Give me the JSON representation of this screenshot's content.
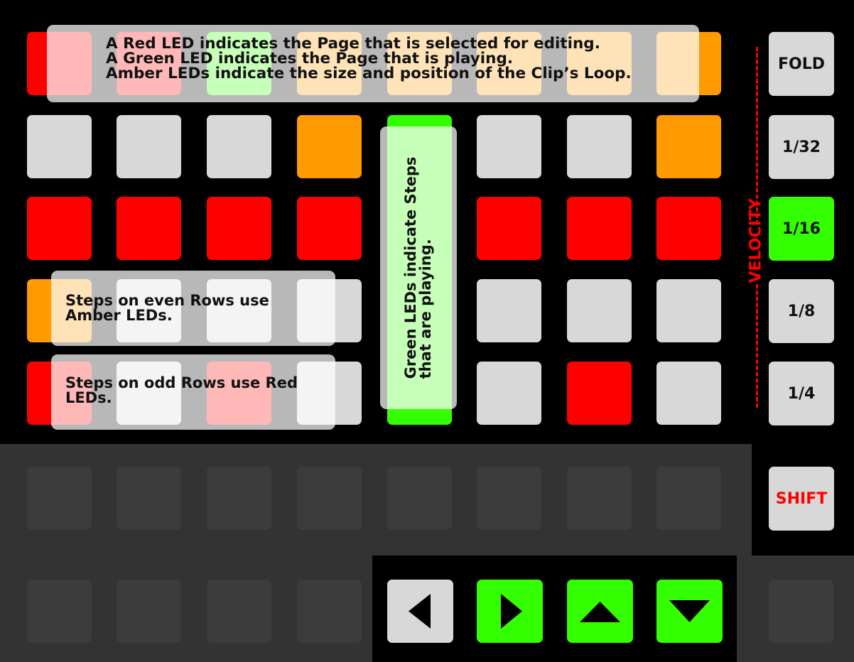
{
  "colors": {
    "red": "#ff0000",
    "amber": "#ff9a00",
    "green": "#33ff00",
    "off": "#d8d8d8",
    "dark_pad": "#3c3c3c",
    "dark_panel": "#333333"
  },
  "grid": {
    "rows": [
      [
        "red",
        "red",
        "green",
        "amber",
        "amber",
        "amber",
        "amber",
        "amber"
      ],
      [
        "off",
        "off",
        "off",
        "amber",
        "green",
        "off",
        "off",
        "amber"
      ],
      [
        "red",
        "red",
        "red",
        "red",
        "green",
        "red",
        "red",
        "red"
      ],
      [
        "amber",
        "off",
        "off",
        "off",
        "green",
        "off",
        "off",
        "off"
      ],
      [
        "red",
        "off",
        "red",
        "off",
        "green",
        "off",
        "red",
        "off"
      ],
      [
        "dark_pad",
        "dark_pad",
        "dark_pad",
        "dark_pad",
        "dark_pad",
        "dark_pad",
        "dark_pad",
        "dark_pad"
      ],
      [
        "dark_pad",
        "dark_pad",
        "dark_pad",
        "dark_pad",
        "off",
        "green",
        "green",
        "green"
      ]
    ]
  },
  "side_buttons": [
    {
      "label": "FOLD",
      "state": "off"
    },
    {
      "label": "1/32",
      "state": "off"
    },
    {
      "label": "1/16",
      "state": "green"
    },
    {
      "label": "1/8",
      "state": "off"
    },
    {
      "label": "1/4",
      "state": "off"
    },
    {
      "label": "SHIFT",
      "state": "off",
      "text_color": "#ff0000"
    }
  ],
  "velocity_label": "VELOCITY",
  "annotations": {
    "top": [
      "A Red LED indicates the Page that is selected for editing.",
      "A Green LED indicates the Page that is playing.",
      "Amber LEDs indicate the size and position of the Clip’s Loop."
    ],
    "vertical": [
      "Green LEDs indicate Steps",
      "that are playing."
    ],
    "even_rows": [
      "Steps on even Rows use",
      "Amber LEDs."
    ],
    "odd_rows": [
      "Steps on odd Rows use Red",
      "LEDs."
    ]
  },
  "arrow_buttons": [
    {
      "icon": "left-arrow-icon",
      "state": "off"
    },
    {
      "icon": "right-arrow-icon",
      "state": "green"
    },
    {
      "icon": "up-arrow-icon",
      "state": "green"
    },
    {
      "icon": "down-arrow-icon",
      "state": "green"
    }
  ]
}
